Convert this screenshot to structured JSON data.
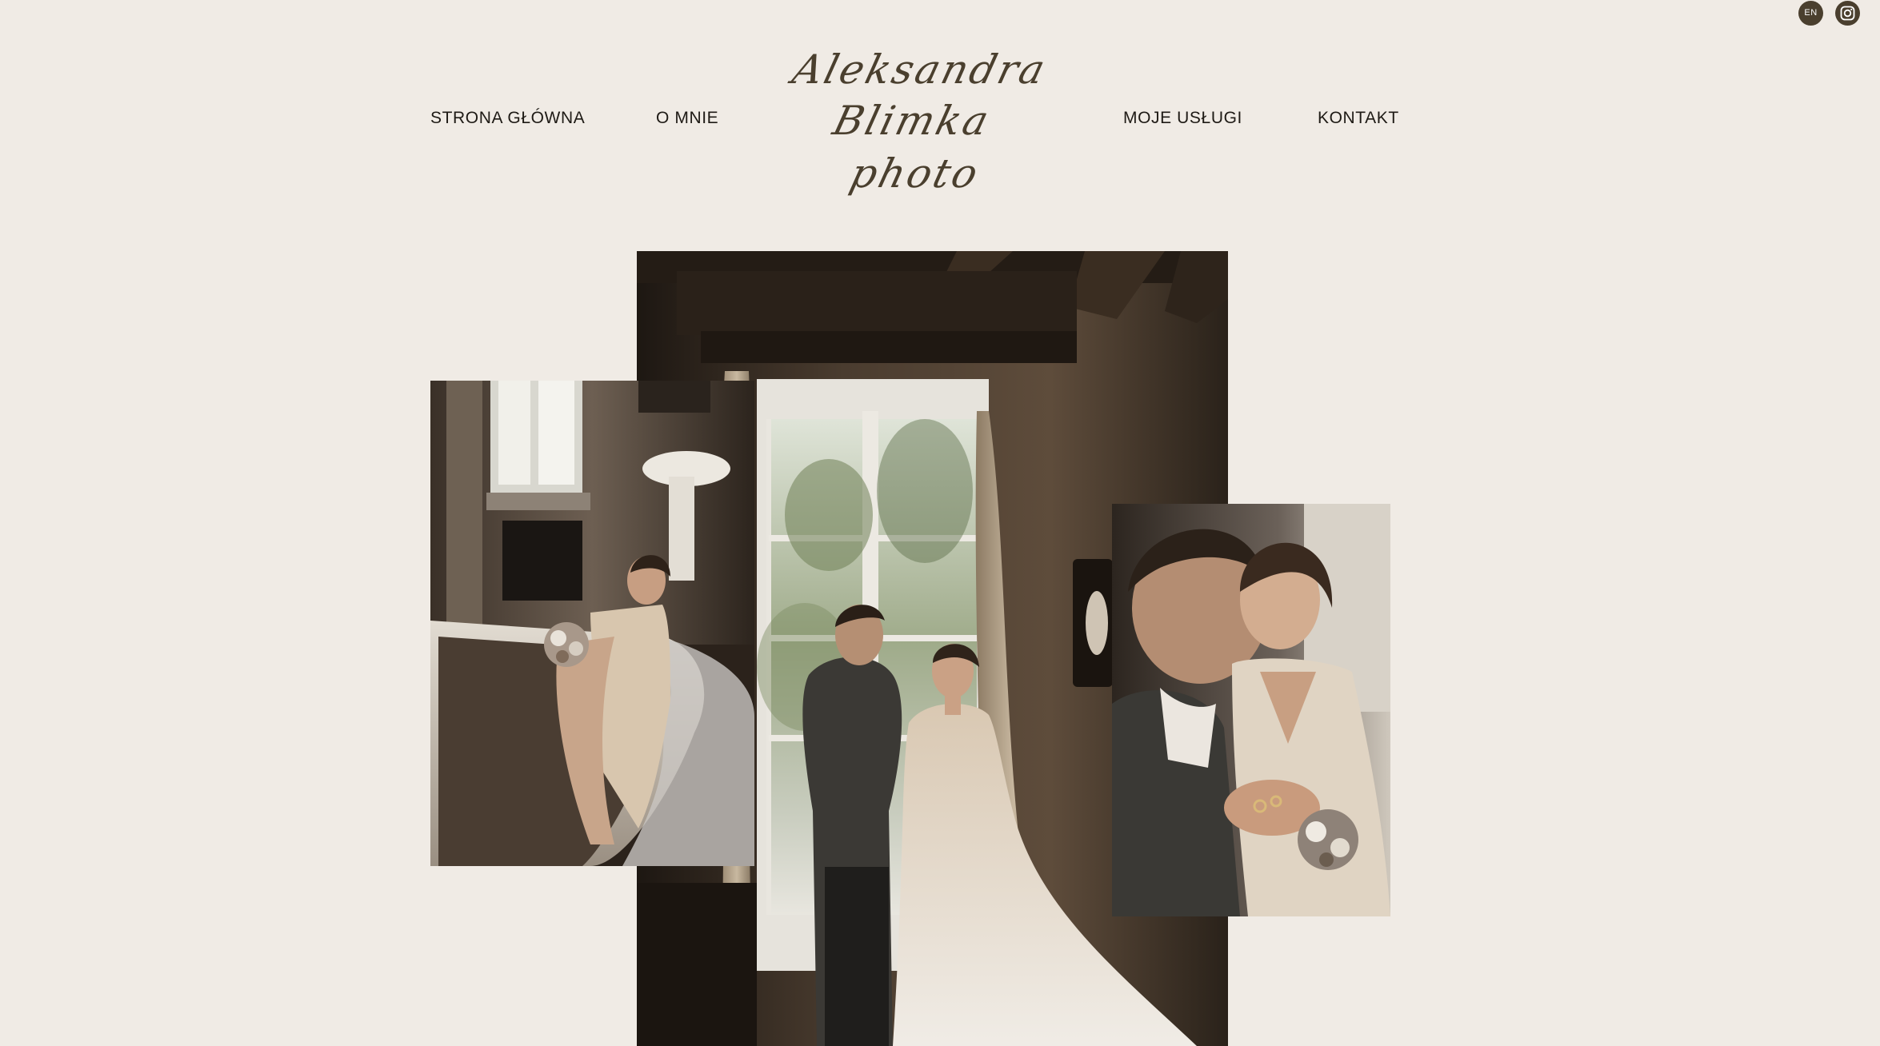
{
  "header": {
    "language": "EN",
    "instagram_icon": "instagram-icon",
    "logo_lines": [
      "Aleksandra",
      "Blimka",
      "photo"
    ]
  },
  "nav": {
    "home": "STRONA GŁÓWNA",
    "about": "O MNIE",
    "services": "MOJE USŁUGI",
    "contact": "KONTAKT"
  },
  "colors": {
    "background": "#f0ebe5",
    "accent": "#4a3f2e",
    "text": "#1e1a15"
  }
}
